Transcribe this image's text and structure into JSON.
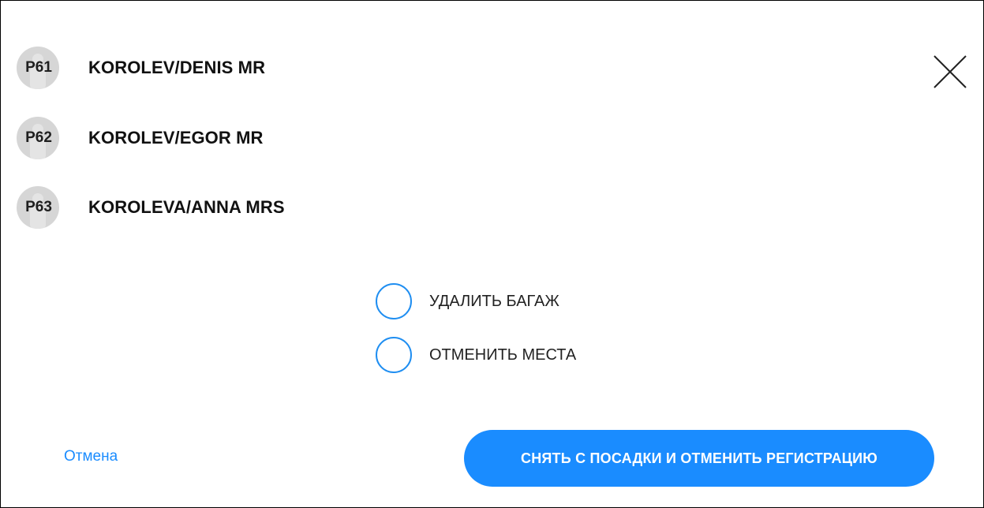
{
  "passengers": [
    {
      "seat": "P61",
      "name": "KOROLEV/DENIS MR"
    },
    {
      "seat": "P62",
      "name": "KOROLEV/EGOR MR"
    },
    {
      "seat": "P63",
      "name": "KOROLEVA/ANNA MRS"
    }
  ],
  "options": [
    {
      "label": "УДАЛИТЬ БАГАЖ",
      "selected": false
    },
    {
      "label": "ОТМЕНИТЬ МЕСТА",
      "selected": false
    }
  ],
  "actions": {
    "cancel_label": "Отмена",
    "primary_label": "СНЯТЬ С ПОСАДКИ И ОТМЕНИТЬ РЕГИСТРАЦИЮ"
  },
  "icons": {
    "avatar": "person-silhouette-icon",
    "close": "close-icon"
  },
  "colors": {
    "accent": "#1a8cff",
    "radio_border": "#1f8ef1",
    "avatar_bg": "#d6d6d6",
    "text": "#111111"
  }
}
